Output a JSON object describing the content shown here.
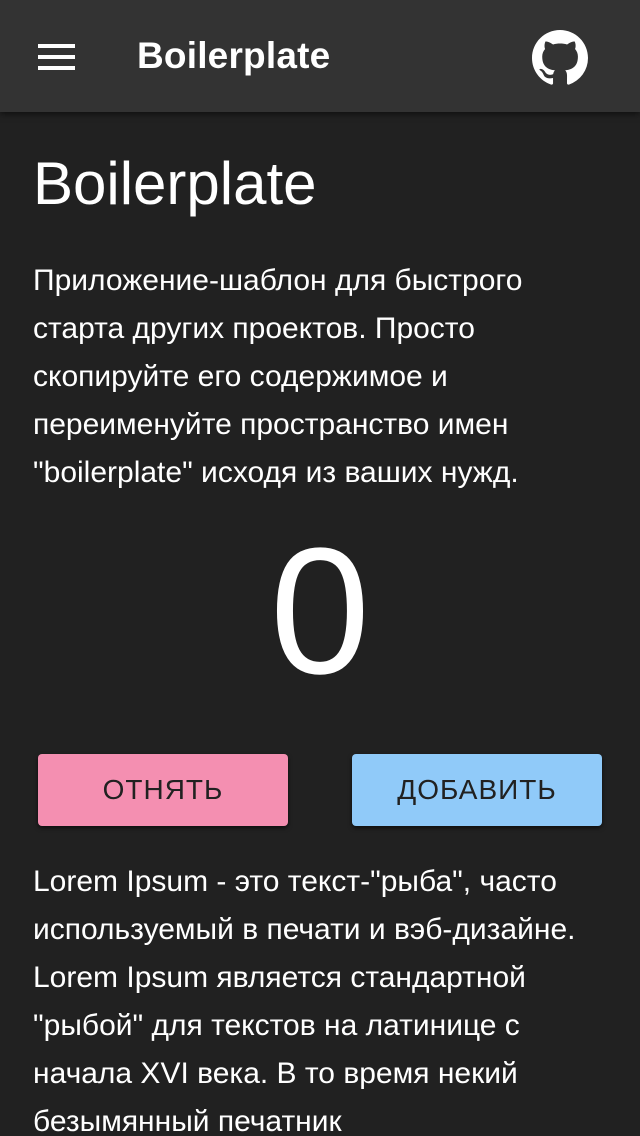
{
  "appbar": {
    "title": "Boilerplate",
    "menu_icon": "menu-icon",
    "github_icon": "github-icon"
  },
  "main": {
    "title": "Boilerplate",
    "intro": "Приложение-шаблон для быстрого старта других проектов. Просто скопируйте его содержимое и переименуйте пространство имен \"boilerplate\" исходя из ваших нужд.",
    "counter": "0",
    "subtract_label": "ОТНЯТЬ",
    "add_label": "ДОБАВИТЬ",
    "lorem": "Lorem Ipsum - это текст-\"рыба\", часто используемый в печати и вэб-дизайне. Lorem Ipsum является стандартной \"рыбой\" для текстов на латинице с начала XVI века. В то время некий безымянный печатник"
  },
  "colors": {
    "background": "#212121",
    "appbar": "#333333",
    "subtract_button": "#f48fb1",
    "add_button": "#90caf9"
  }
}
